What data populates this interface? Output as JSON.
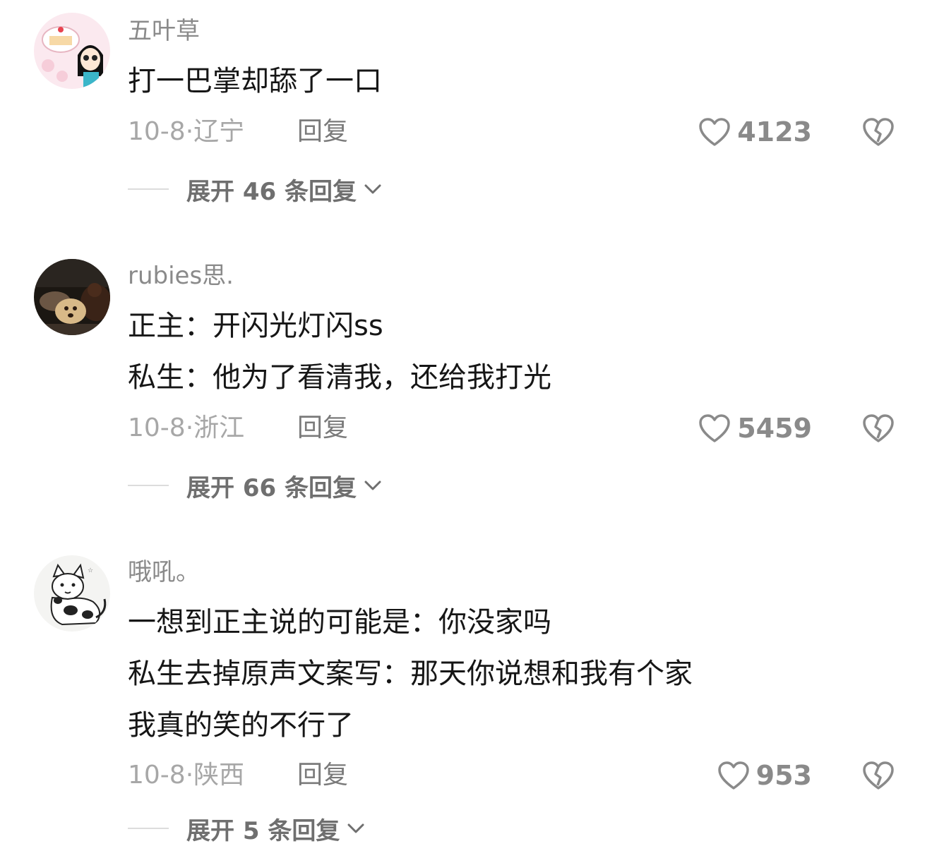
{
  "comments": [
    {
      "username": "五叶草",
      "lines": [
        "打一巴掌却舔了一口"
      ],
      "date": "10-8",
      "location": "辽宁",
      "reply_label": "回复",
      "likes": "4123",
      "expand_label": "展开 46 条回复"
    },
    {
      "username": "rubies思.",
      "lines": [
        "正主：开闪光灯闪ss",
        "私生：他为了看清我，还给我打光"
      ],
      "date": "10-8",
      "location": "浙江",
      "reply_label": "回复",
      "likes": "5459",
      "expand_label": "展开 66 条回复"
    },
    {
      "username": "哦吼。",
      "lines": [
        "一想到正主说的可能是：你没家吗",
        "私生去掉原声文案写：那天你说想和我有个家",
        "我真的笑的不行了"
      ],
      "date": "10-8",
      "location": "陕西",
      "reply_label": "回复",
      "likes": "953",
      "expand_label": "展开 5 条回复"
    }
  ],
  "icons": {
    "like": "heart-outline-icon",
    "dislike": "broken-heart-icon",
    "expand": "chevron-down-icon"
  },
  "colors": {
    "username": "#8a8a8a",
    "text": "#161616",
    "meta": "#a7a7a7",
    "icon": "#8a8a8a"
  }
}
